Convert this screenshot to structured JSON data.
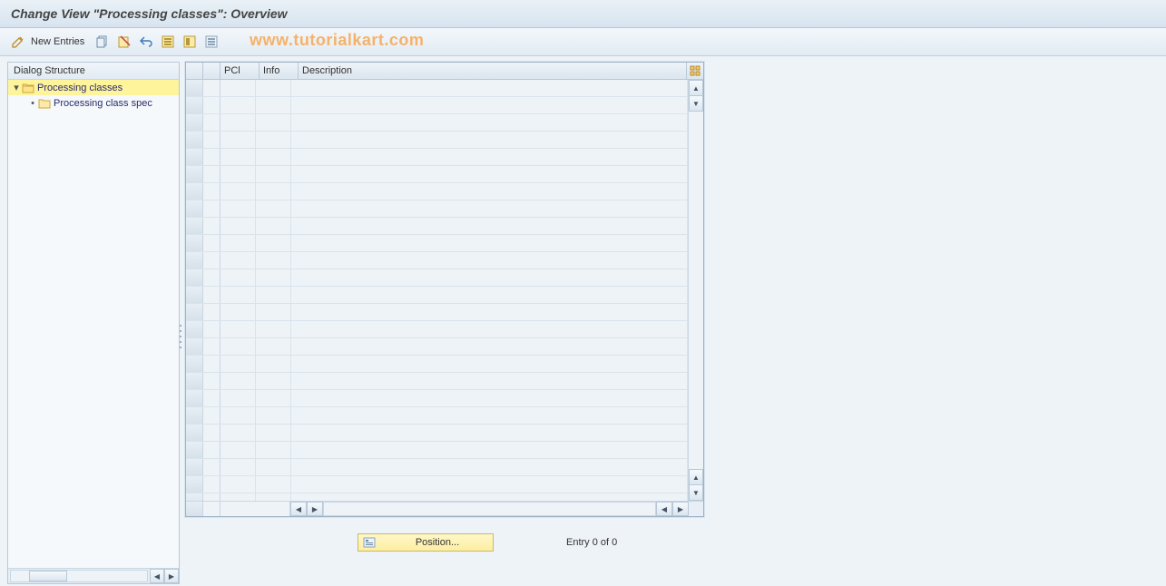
{
  "title": "Change View \"Processing classes\": Overview",
  "toolbar": {
    "new_entries_label": "New Entries"
  },
  "watermark": "www.tutorialkart.com",
  "dialog_structure": {
    "header": "Dialog Structure",
    "root": {
      "label": "Processing classes",
      "child": {
        "label": "Processing class spec"
      }
    }
  },
  "grid": {
    "columns": {
      "pcl": "PCl",
      "info": "Info",
      "description": "Description"
    },
    "widths": {
      "pcl": 38,
      "info": 38,
      "description": 420
    },
    "row_count": 25
  },
  "footer": {
    "position_label": "Position...",
    "entry_status": "Entry 0 of 0"
  }
}
